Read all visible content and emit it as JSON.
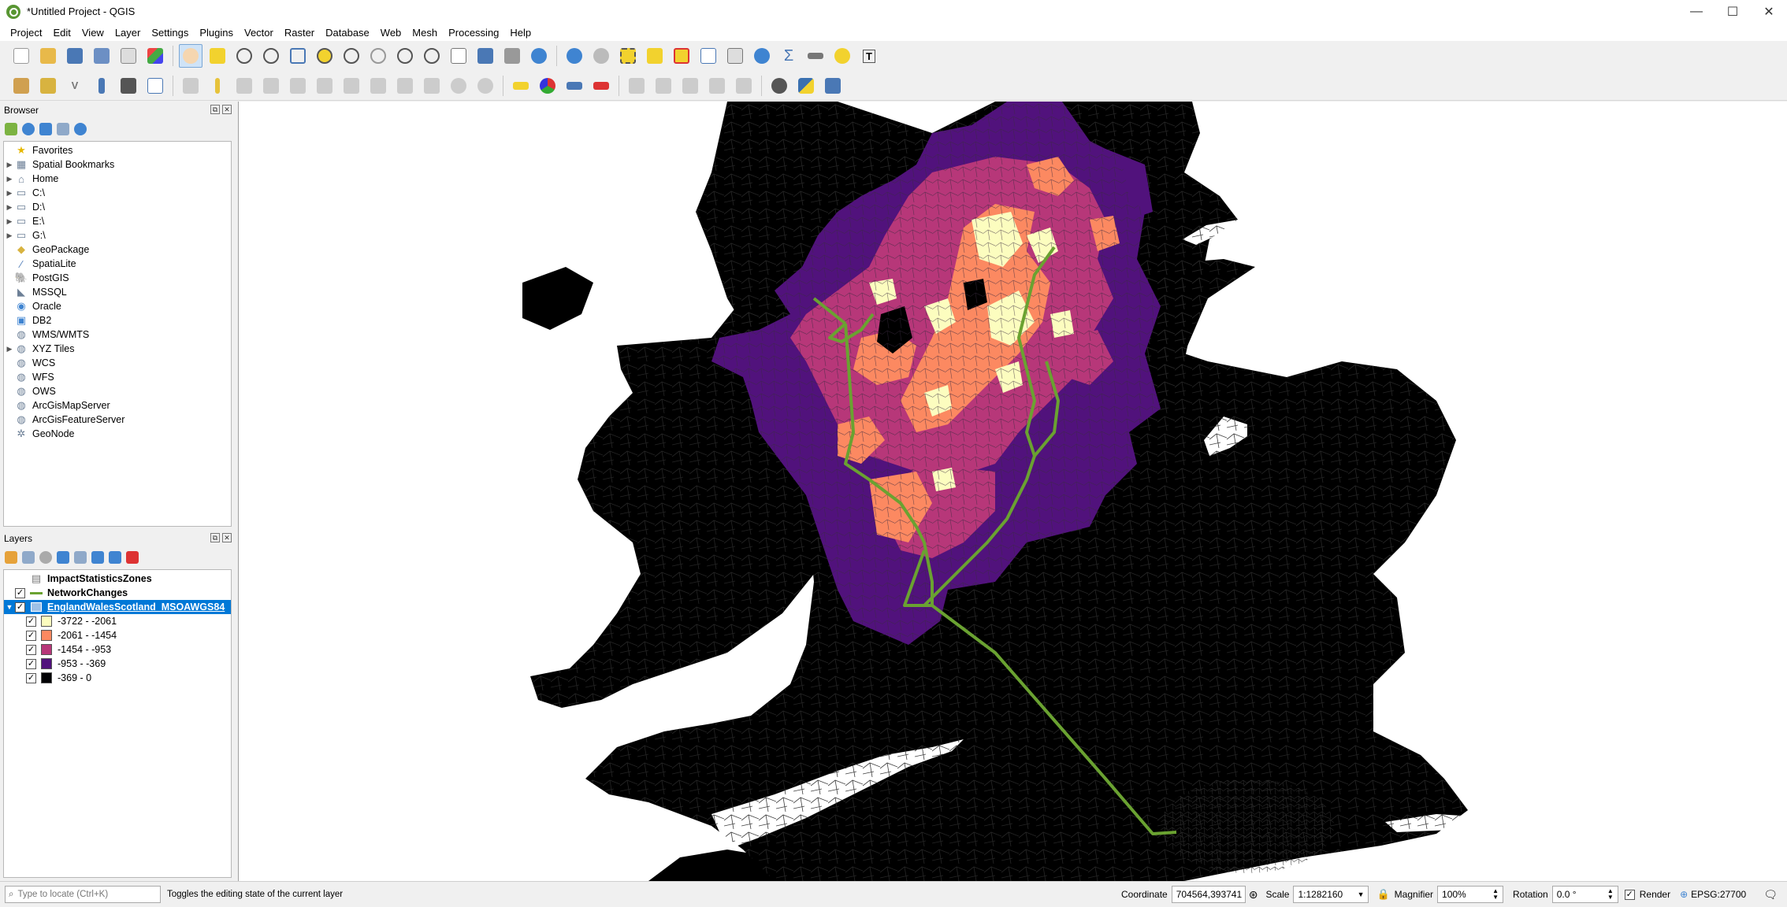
{
  "window": {
    "title": "*Untitled Project - QGIS",
    "controls": {
      "minimize": "—",
      "maximize": "☐",
      "close": "✕"
    }
  },
  "menu": [
    "Project",
    "Edit",
    "View",
    "Layer",
    "Settings",
    "Plugins",
    "Vector",
    "Raster",
    "Database",
    "Web",
    "Mesh",
    "Processing",
    "Help"
  ],
  "browser": {
    "title": "Browser",
    "items": [
      {
        "label": "Favorites",
        "icon": "star-icon",
        "expandable": false
      },
      {
        "label": "Spatial Bookmarks",
        "icon": "bookmark-icon",
        "expandable": true
      },
      {
        "label": "Home",
        "icon": "home-folder-icon",
        "expandable": true
      },
      {
        "label": "C:\\",
        "icon": "folder-icon",
        "expandable": true
      },
      {
        "label": "D:\\",
        "icon": "folder-icon",
        "expandable": true
      },
      {
        "label": "E:\\",
        "icon": "folder-icon",
        "expandable": true
      },
      {
        "label": "G:\\",
        "icon": "folder-icon",
        "expandable": true
      },
      {
        "label": "GeoPackage",
        "icon": "geopackage-icon",
        "expandable": false
      },
      {
        "label": "SpatiaLite",
        "icon": "spatialite-icon",
        "expandable": false
      },
      {
        "label": "PostGIS",
        "icon": "postgis-icon",
        "expandable": false
      },
      {
        "label": "MSSQL",
        "icon": "mssql-icon",
        "expandable": false
      },
      {
        "label": "Oracle",
        "icon": "oracle-icon",
        "expandable": false
      },
      {
        "label": "DB2",
        "icon": "db2-icon",
        "expandable": false
      },
      {
        "label": "WMS/WMTS",
        "icon": "wms-icon",
        "expandable": false
      },
      {
        "label": "XYZ Tiles",
        "icon": "xyz-tiles-icon",
        "expandable": true
      },
      {
        "label": "WCS",
        "icon": "wcs-icon",
        "expandable": false
      },
      {
        "label": "WFS",
        "icon": "wfs-icon",
        "expandable": false
      },
      {
        "label": "OWS",
        "icon": "ows-icon",
        "expandable": false
      },
      {
        "label": "ArcGisMapServer",
        "icon": "arcgis-map-icon",
        "expandable": false
      },
      {
        "label": "ArcGisFeatureServer",
        "icon": "arcgis-feature-icon",
        "expandable": false
      },
      {
        "label": "GeoNode",
        "icon": "geonode-icon",
        "expandable": false
      }
    ]
  },
  "layers": {
    "title": "Layers",
    "items": [
      {
        "label": "ImpactStatisticsZones",
        "checked": null,
        "kind": "table"
      },
      {
        "label": "NetworkChanges",
        "checked": true,
        "kind": "line"
      },
      {
        "label": "EnglandWalesScotland_MSOAWGS84",
        "checked": true,
        "kind": "polygon",
        "selected": true
      }
    ],
    "legend": [
      {
        "label": "-3722 - -2061",
        "color": "#fcfdbf"
      },
      {
        "label": "-2061 - -1454",
        "color": "#fc8961"
      },
      {
        "label": "-1454 - -953",
        "color": "#b73779"
      },
      {
        "label": "-953 - -369",
        "color": "#51127c"
      },
      {
        "label": "-369 - 0",
        "color": "#000004"
      }
    ]
  },
  "map": {
    "background": "#ffffff",
    "land_color": "#000000",
    "network_color": "#6aa231"
  },
  "status": {
    "locator_placeholder": "Type to locate (Ctrl+K)",
    "message": "Toggles the editing state of the current layer",
    "coordinate_label": "Coordinate",
    "coordinate": "704564,393741",
    "scale_label": "Scale",
    "scale": "1:1282160",
    "magnifier_label": "Magnifier",
    "magnifier": "100%",
    "rotation_label": "Rotation",
    "rotation": "0.0 °",
    "render_label": "Render",
    "crs": "EPSG:27700"
  }
}
